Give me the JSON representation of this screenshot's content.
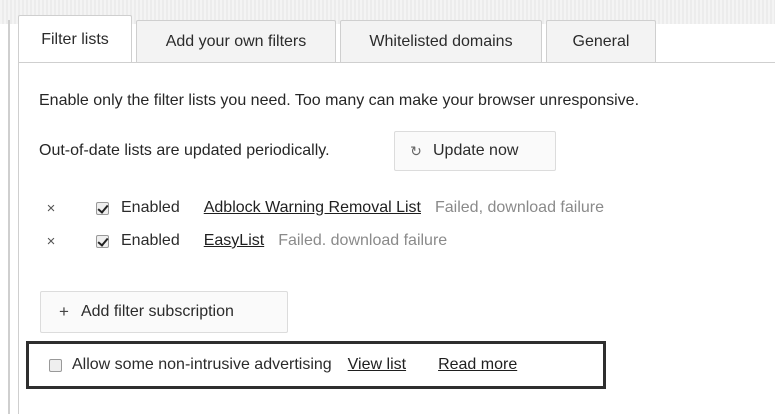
{
  "tabs": [
    {
      "label": "Filter lists",
      "active": true
    },
    {
      "label": "Add your own filters",
      "active": false
    },
    {
      "label": "Whitelisted domains",
      "active": false
    },
    {
      "label": "General",
      "active": false
    }
  ],
  "intro_text": "Enable only the filter lists you need. Too many can make your browser unresponsive.",
  "update_text": "Out-of-date lists are updated periodically.",
  "update_button": {
    "icon": "refresh-icon",
    "label": "Update now"
  },
  "filter_lists": [
    {
      "remove_icon": "×",
      "checked": true,
      "enabled_label": "Enabled",
      "name": "Adblock Warning Removal List",
      "status": "Failed, download failure"
    },
    {
      "remove_icon": "×",
      "checked": true,
      "enabled_label": "Enabled",
      "name": "EasyList",
      "status": "Failed. download failure"
    }
  ],
  "add_subscription_button": {
    "icon": "+",
    "label": "Add filter subscription"
  },
  "acceptable_ads": {
    "checked": false,
    "label": "Allow some non-intrusive advertising",
    "view_link": "View list",
    "read_more_link": "Read more"
  }
}
